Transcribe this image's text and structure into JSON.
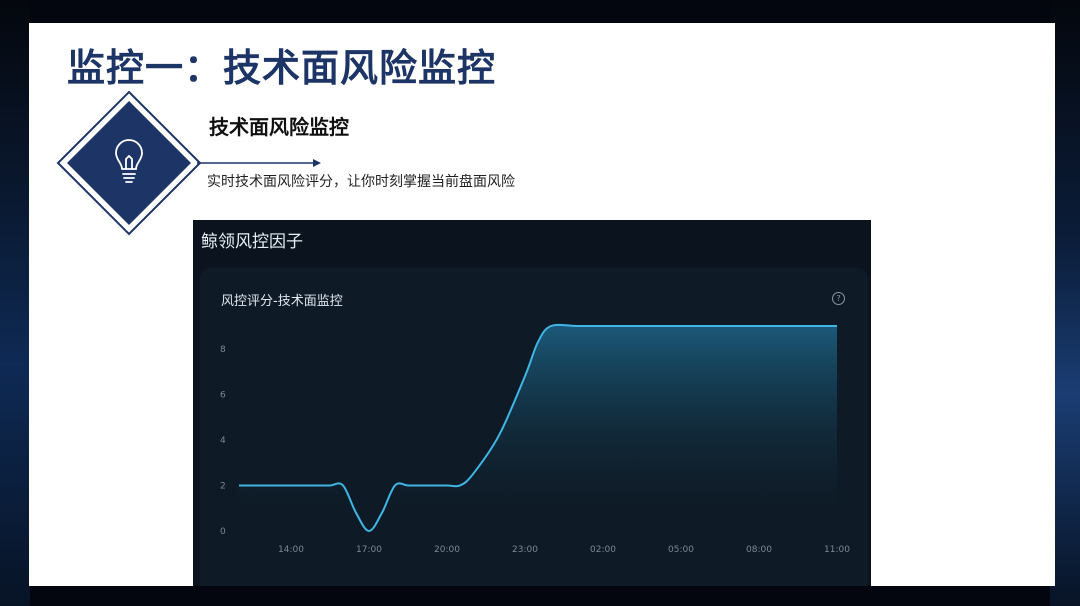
{
  "slide": {
    "title": "监控一：技术面风险监控",
    "section_heading": "技术面风险监控",
    "section_subtitle": "实时技术面风险评分，让你时刻掌握当前盘面风险",
    "icon": "lightbulb-icon"
  },
  "panel": {
    "title": "鲸领风控因子",
    "card_title": "风控评分-技术面监控",
    "help_icon": "question-circle-icon",
    "help_glyph": "?"
  },
  "colors": {
    "title": "#1d3566",
    "diamond_fill": "#1d3566",
    "line": "#3fb6e6"
  },
  "chart_data": {
    "type": "area",
    "title": "风控评分-技术面监控",
    "xlabel": "",
    "ylabel": "",
    "ylim": [
      0,
      9
    ],
    "yticks": [
      0,
      2,
      4,
      6,
      8
    ],
    "xticks": [
      "14:00",
      "17:00",
      "20:00",
      "23:00",
      "02:00",
      "05:00",
      "08:00",
      "11:00"
    ],
    "grid": false,
    "x_hours": [
      12,
      13,
      14,
      15,
      15.5,
      16,
      16.5,
      17,
      17.5,
      18,
      18.5,
      19,
      20,
      20.5,
      21,
      22,
      23,
      23.5,
      24,
      25,
      26,
      29,
      32,
      35
    ],
    "values": [
      2,
      2,
      2,
      2,
      2,
      2,
      0.8,
      0,
      0.8,
      2,
      2,
      2,
      2,
      2,
      2.5,
      4.2,
      6.8,
      8.3,
      9,
      9,
      9,
      9,
      9,
      9
    ]
  }
}
